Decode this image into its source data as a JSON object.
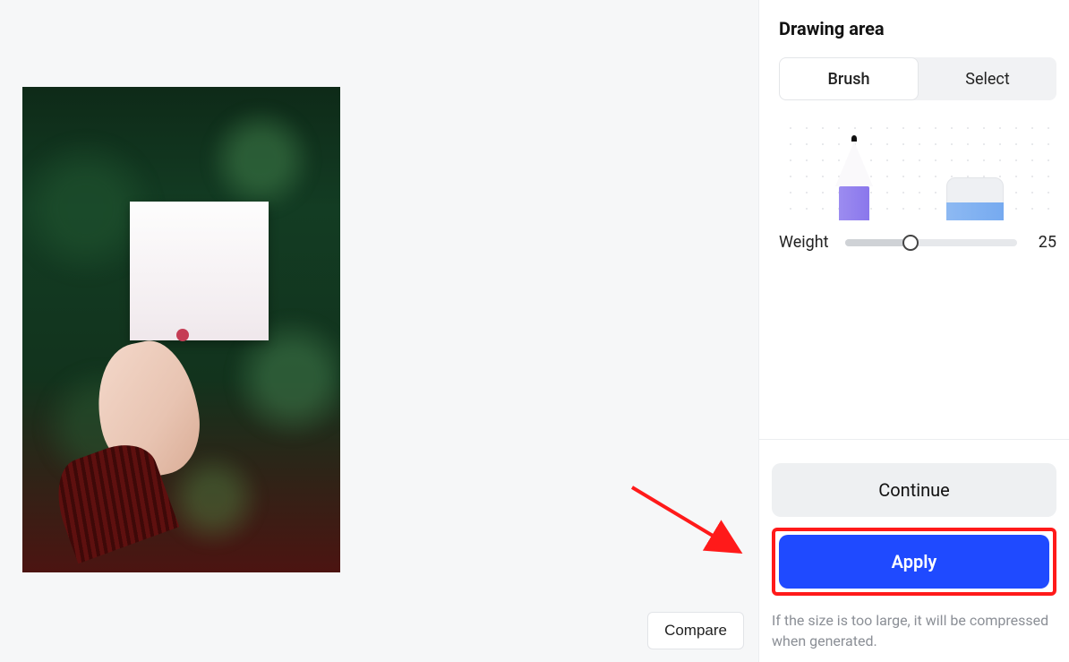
{
  "sidebar": {
    "title": "Drawing area",
    "modes": {
      "brush": "Brush",
      "select": "Select",
      "active": "brush"
    },
    "weight": {
      "label": "Weight",
      "value": 25,
      "min": 1,
      "max": 100
    }
  },
  "actions": {
    "continue_label": "Continue",
    "apply_label": "Apply"
  },
  "hint": "If the size is too large, it will be compressed when generated.",
  "canvas": {
    "compare_label": "Compare"
  }
}
